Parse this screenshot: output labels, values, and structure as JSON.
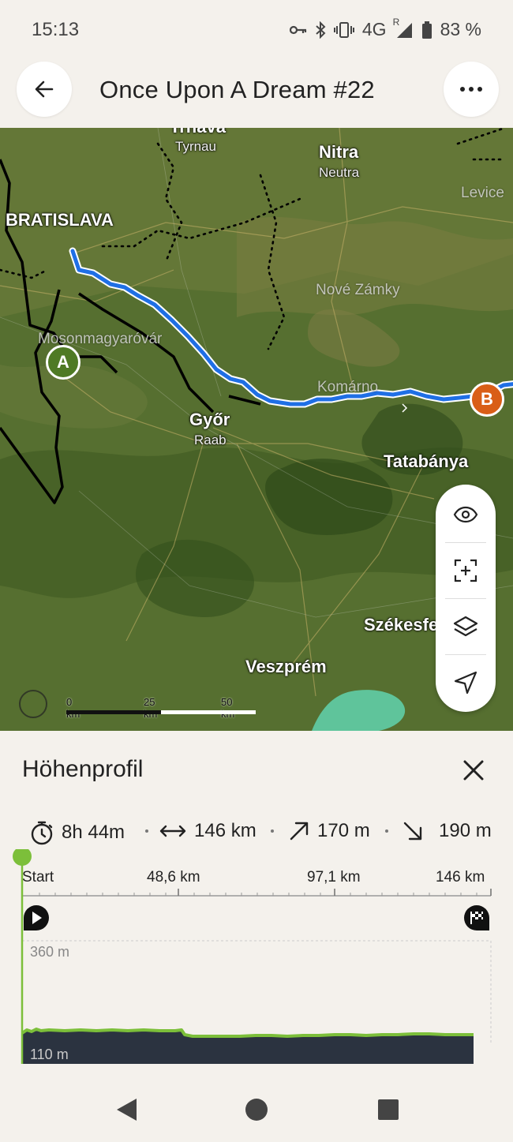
{
  "status_bar": {
    "time": "15:13",
    "network": "4G",
    "roaming": "R",
    "battery": "83 %",
    "icons": [
      "key-icon",
      "bluetooth-icon",
      "vibrate-icon",
      "signal-icon",
      "battery-icon"
    ]
  },
  "header": {
    "title": "Once Upon A Dream #22",
    "back_icon": "arrow-left-icon",
    "more_icon": "more-horizontal-icon"
  },
  "map": {
    "places": {
      "trnava": "Trnava",
      "tyrnau": "Tyrnau",
      "nitra": "Nitra",
      "neutra": "Neutra",
      "levice": "Levice",
      "bratislava": "BRATISLAVA",
      "nove_zamky": "Nové Zámky",
      "mosonmagyarovar": "Mosonmagyaróvár",
      "komarno": "Komárno",
      "gyor": "Győr",
      "raab": "Raab",
      "tatabanya": "Tatabánya",
      "szekesfehervar": "Székesfehérvár",
      "veszprem": "Veszprém"
    },
    "start_marker": "A",
    "end_marker": "B",
    "scale": {
      "label_0": "0 km",
      "label_25": "25 km",
      "label_50": "50 km"
    },
    "controls": [
      "eye-icon",
      "focus-plus-icon",
      "layers-icon",
      "navigate-icon"
    ],
    "colors": {
      "route": "#1f6fe5",
      "start": "#4f7a25",
      "end": "#d95e17"
    }
  },
  "elevation_panel": {
    "title": "Höhenprofil",
    "close_icon": "close-icon",
    "stats": {
      "duration": "8h 44m",
      "distance": "146 km",
      "ascent": "170 m",
      "descent": "190 m"
    },
    "axis": {
      "start": "Start",
      "t1": "48,6 km",
      "t2": "97,1 km",
      "end": "146 km"
    },
    "elevation_max": "360 m",
    "elevation_min": "110 m",
    "start_icon": "play-flag-icon",
    "finish_icon": "checkered-flag-icon",
    "accent": "#7cbf3a"
  },
  "navbar": {
    "icons": [
      "back-triangle-icon",
      "home-circle-icon",
      "recents-square-icon"
    ]
  }
}
